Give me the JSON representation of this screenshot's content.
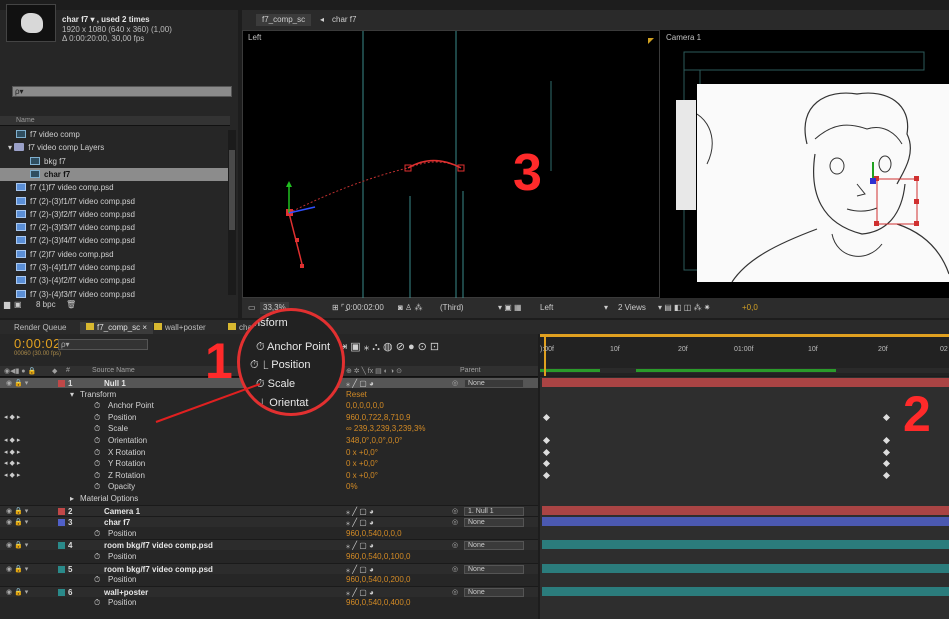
{
  "project": {
    "comp_name": "char f7 ▾ , used 2 times",
    "comp_size": "1920 x 1080  (640 x 360) (1,00)",
    "comp_duration": "Δ 0:00:20:00, 30,00 fps",
    "search_placeholder": "ρ▾",
    "name_header": "Name",
    "items": [
      {
        "label": "f7 video comp",
        "icon": "comp-icon"
      },
      {
        "label": "f7 video comp Layers",
        "icon": "folder-icon"
      },
      {
        "label": "bkg f7",
        "icon": "comp-icon"
      },
      {
        "label": "char f7",
        "icon": "comp-icon",
        "selected": true
      },
      {
        "label": "f7 (1)f7 video comp.psd",
        "icon": "psd-icon"
      },
      {
        "label": "f7 (2)-(3)f1/f7 video comp.psd",
        "icon": "psd-icon"
      },
      {
        "label": "f7 (2)-(3)f2/f7 video comp.psd",
        "icon": "psd-icon"
      },
      {
        "label": "f7 (2)-(3)f3/f7 video comp.psd",
        "icon": "psd-icon"
      },
      {
        "label": "f7 (2)-(3)f4/f7 video comp.psd",
        "icon": "psd-icon"
      },
      {
        "label": "f7 (2)f7 video comp.psd",
        "icon": "psd-icon"
      },
      {
        "label": "f7 (3)-(4)f1/f7 video comp.psd",
        "icon": "psd-icon"
      },
      {
        "label": "f7 (3)-(4)f2/f7 video comp.psd",
        "icon": "psd-icon"
      },
      {
        "label": "f7 (3)-(4)f3/f7 video comp.psd",
        "icon": "psd-icon"
      }
    ],
    "footer_bpc": "8 bpc"
  },
  "viewer": {
    "tab_comp": "f7_comp_sc",
    "tab_sep": "◂",
    "tab_char": "char f7",
    "left_label": "Left",
    "right_label": "Camera 1",
    "toolbar": {
      "zoom": "33,3%",
      "time": "0:00:02:00",
      "resolution": "(Third)",
      "view": "Left",
      "views": "2 Views",
      "exposure": "+0,0"
    }
  },
  "timeline": {
    "tabs": [
      "Render Queue",
      "f7_comp_sc ×",
      "wall+poster",
      "char"
    ],
    "timecode": "0:00:02:00",
    "timecode_frames": "00060 (30.00 fps)",
    "search_placeholder": "ρ▾",
    "col_hash": "#",
    "col_source": "Source Name",
    "col_switches": "⊕ ✲ ╲ fx ▤ ◐ ◑ ⊙",
    "col_parent": "Parent",
    "ruler_labels": [
      "):00f",
      "10f",
      "20f",
      "01:00f",
      "10f",
      "20f",
      "02"
    ],
    "rows": [
      {
        "kind": "layer",
        "num": "1",
        "name": "Null 1",
        "color": "#c04848",
        "selected": true,
        "parent": "None"
      },
      {
        "kind": "group",
        "name": "Transform",
        "value": "Reset"
      },
      {
        "kind": "prop",
        "name": "Anchor Point",
        "value": "0,0,0,0,0,0"
      },
      {
        "kind": "prop",
        "name": "Position",
        "value": "960,0,722,8,710,9",
        "keyed": true
      },
      {
        "kind": "prop",
        "name": "Scale",
        "value": "∞ 239,3,239,3,239,3%"
      },
      {
        "kind": "prop",
        "name": "Orientation",
        "value": "348,0°,0,0°,0,0°",
        "keyed": true
      },
      {
        "kind": "prop",
        "name": "X Rotation",
        "value": "0 x +0,0°",
        "keyed": true
      },
      {
        "kind": "prop",
        "name": "Y Rotation",
        "value": "0 x +0,0°",
        "keyed": true
      },
      {
        "kind": "prop",
        "name": "Z Rotation",
        "value": "0 x +0,0°",
        "keyed": true
      },
      {
        "kind": "prop",
        "name": "Opacity",
        "value": "0%"
      },
      {
        "kind": "group",
        "name": "Material Options",
        "value": ""
      },
      {
        "kind": "layer",
        "num": "2",
        "name": "Camera 1",
        "color": "#c04848",
        "parent": "1. Null 1"
      },
      {
        "kind": "layer",
        "num": "3",
        "name": "char f7",
        "color": "#5060c8",
        "parent": "None"
      },
      {
        "kind": "prop",
        "name": "Position",
        "value": "960,0,540,0,0,0"
      },
      {
        "kind": "layer",
        "num": "4",
        "name": "room bkg/f7 video comp.psd",
        "color": "#2a8a8a",
        "parent": "None"
      },
      {
        "kind": "prop",
        "name": "Position",
        "value": "960,0,540,0,100,0"
      },
      {
        "kind": "layer",
        "num": "5",
        "name": "room bkg/f7 video comp.psd",
        "color": "#2a8a8a",
        "parent": "None"
      },
      {
        "kind": "prop",
        "name": "Position",
        "value": "960,0,540,0,200,0"
      },
      {
        "kind": "layer",
        "num": "6",
        "name": "wall+poster",
        "color": "#2a8a8a",
        "parent": "None"
      },
      {
        "kind": "prop",
        "name": "Position",
        "value": "960,0,540,0,400,0"
      }
    ]
  },
  "zoom_overlay": {
    "title": "nsform",
    "items": [
      "Anchor Point",
      "Position",
      "Scale",
      "Orientat"
    ]
  },
  "annotations": {
    "one": "1",
    "two": "2",
    "three": "3"
  },
  "colors": {
    "accent_orange": "#d28a25",
    "annotation_red": "#ff2a2a",
    "layer_red": "#b04a4a",
    "layer_blue": "#4a62c0",
    "layer_teal": "#2b8a8a"
  }
}
